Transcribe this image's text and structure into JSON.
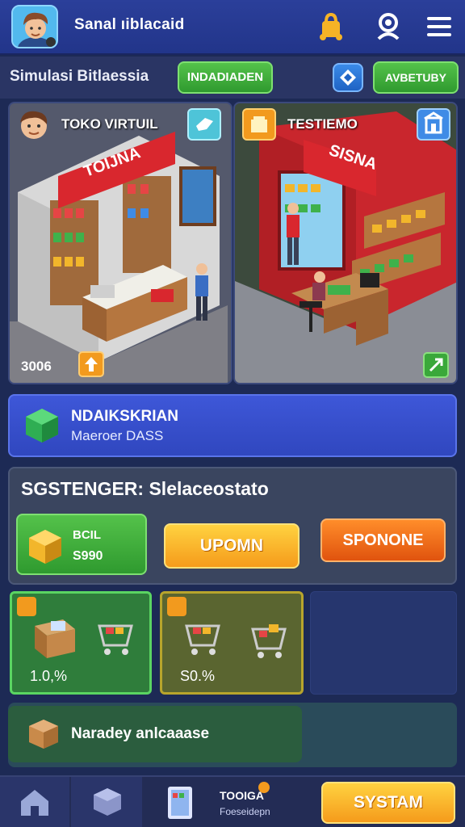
{
  "header": {
    "title": "Sanal ıiblacaid",
    "icons": [
      "avatar-portrait",
      "bag-icon",
      "profile-icon",
      "menu-icon"
    ]
  },
  "subheader": {
    "title": "Simulasi Bitlaessia",
    "button_label": "INDADIADEN",
    "icon_button": "diamond-icon",
    "right_button_label": "AVBETUBY"
  },
  "stores": [
    {
      "label": "TOKO VIRTUIL",
      "sign": "TOIJNA",
      "stat": "3006",
      "colors": {
        "sign": "#d9272e"
      }
    },
    {
      "label": "TESTIEMO",
      "sign": "SISNA",
      "colors": {
        "sign": "#d9272e"
      }
    }
  ],
  "info": {
    "title": "NDAIKSKRIAN",
    "subtitle": "Maeroer DASS"
  },
  "status": {
    "title": "SGSTENGER: Slelaceostato",
    "card_title": "BCIL",
    "card_value": "S990",
    "button_upgrade": "UPOMN",
    "button_sponsor": "SPONONE"
  },
  "cards": [
    {
      "value": "1.0,%"
    },
    {
      "value": "S0.%"
    }
  ],
  "banner": {
    "text": "Naradey anlcaaase"
  },
  "bottom_nav": {
    "item_title": "TOOIGA",
    "item_subtitle": "Foeseidepn",
    "system_button": "SYSTAM"
  },
  "colors": {
    "header_bg": "#22358a",
    "accent_green": "#3aa83a",
    "accent_orange": "#f26a17",
    "accent_yellow": "#f8b428",
    "info_blue": "#3047bf"
  }
}
